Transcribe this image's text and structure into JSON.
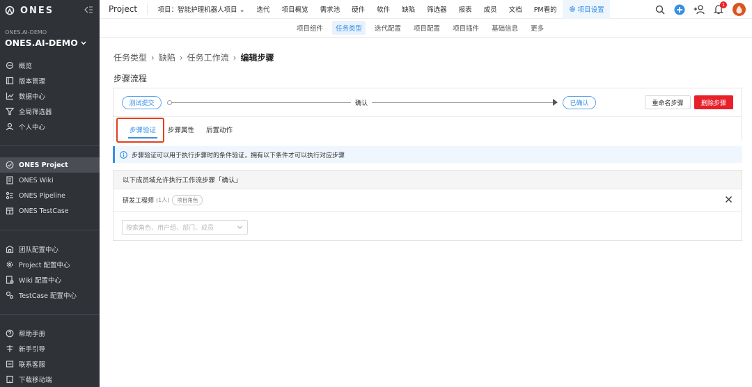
{
  "sidebar": {
    "logo_text": "ONES",
    "org_small": "ONES.AI-DEMO",
    "org_name": "ONES.AI-DEMO",
    "nav_top": [
      {
        "label": "概览",
        "icon": "overview-icon"
      },
      {
        "label": "版本管理",
        "icon": "version-icon"
      },
      {
        "label": "数据中心",
        "icon": "chart-icon"
      },
      {
        "label": "全局筛选器",
        "icon": "filter-icon"
      },
      {
        "label": "个人中心",
        "icon": "user-icon"
      }
    ],
    "nav_products": [
      {
        "label": "ONES Project",
        "icon": "project-icon"
      },
      {
        "label": "ONES Wiki",
        "icon": "wiki-icon"
      },
      {
        "label": "ONES Pipeline",
        "icon": "pipeline-icon"
      },
      {
        "label": "ONES TestCase",
        "icon": "testcase-icon"
      }
    ],
    "nav_config": [
      {
        "label": "团队配置中心",
        "icon": "team-config-icon"
      },
      {
        "label": "Project 配置中心",
        "icon": "gear-icon"
      },
      {
        "label": "Wiki 配置中心",
        "icon": "wiki-config-icon"
      },
      {
        "label": "TestCase 配置中心",
        "icon": "testcase-config-icon"
      }
    ],
    "nav_help": [
      {
        "label": "帮助手册",
        "icon": "help-icon"
      },
      {
        "label": "新手引导",
        "icon": "guide-icon"
      },
      {
        "label": "联系客服",
        "icon": "support-icon"
      },
      {
        "label": "下载移动端",
        "icon": "mobile-icon"
      }
    ]
  },
  "topbar": {
    "product": "Project",
    "items": [
      "项目：智能护理机器人项目 ⌄",
      "迭代",
      "项目概览",
      "需求池",
      "硬件",
      "软件",
      "缺陷",
      "筛选器",
      "报表",
      "成员",
      "文档",
      "PM看的"
    ],
    "settings": "项目设置",
    "notification_count": "1"
  },
  "subnav": {
    "items": [
      "项目组件",
      "任务类型",
      "迭代配置",
      "项目配置",
      "项目插件",
      "基础信息",
      "更多"
    ]
  },
  "breadcrumb": {
    "items": [
      "任务类型",
      "缺陷",
      "任务工作流"
    ],
    "current": "编辑步骤"
  },
  "section_title": "步骤流程",
  "flow": {
    "from_state": "测试提交",
    "step_name": "确认",
    "to_state": "已确认",
    "rename_label": "重命名步骤",
    "delete_label": "删除步骤"
  },
  "tabs": [
    "步骤验证",
    "步骤属性",
    "后置动作"
  ],
  "info_text": "步骤验证可以用于执行步骤时的条件验证，拥有以下条件才可以执行对应步骤",
  "condition": {
    "header": "以下成员域允许执行工作流步骤「确认」",
    "role_name": "研发工程师",
    "role_count": "(1人)",
    "role_tag": "项目角色",
    "search_placeholder": "搜索角色、用户组、部门、成员"
  },
  "colors": {
    "accent": "#338fe5",
    "danger": "#e8202a",
    "sidebar_bg": "#2f3237",
    "highlight": "#e4401b"
  }
}
